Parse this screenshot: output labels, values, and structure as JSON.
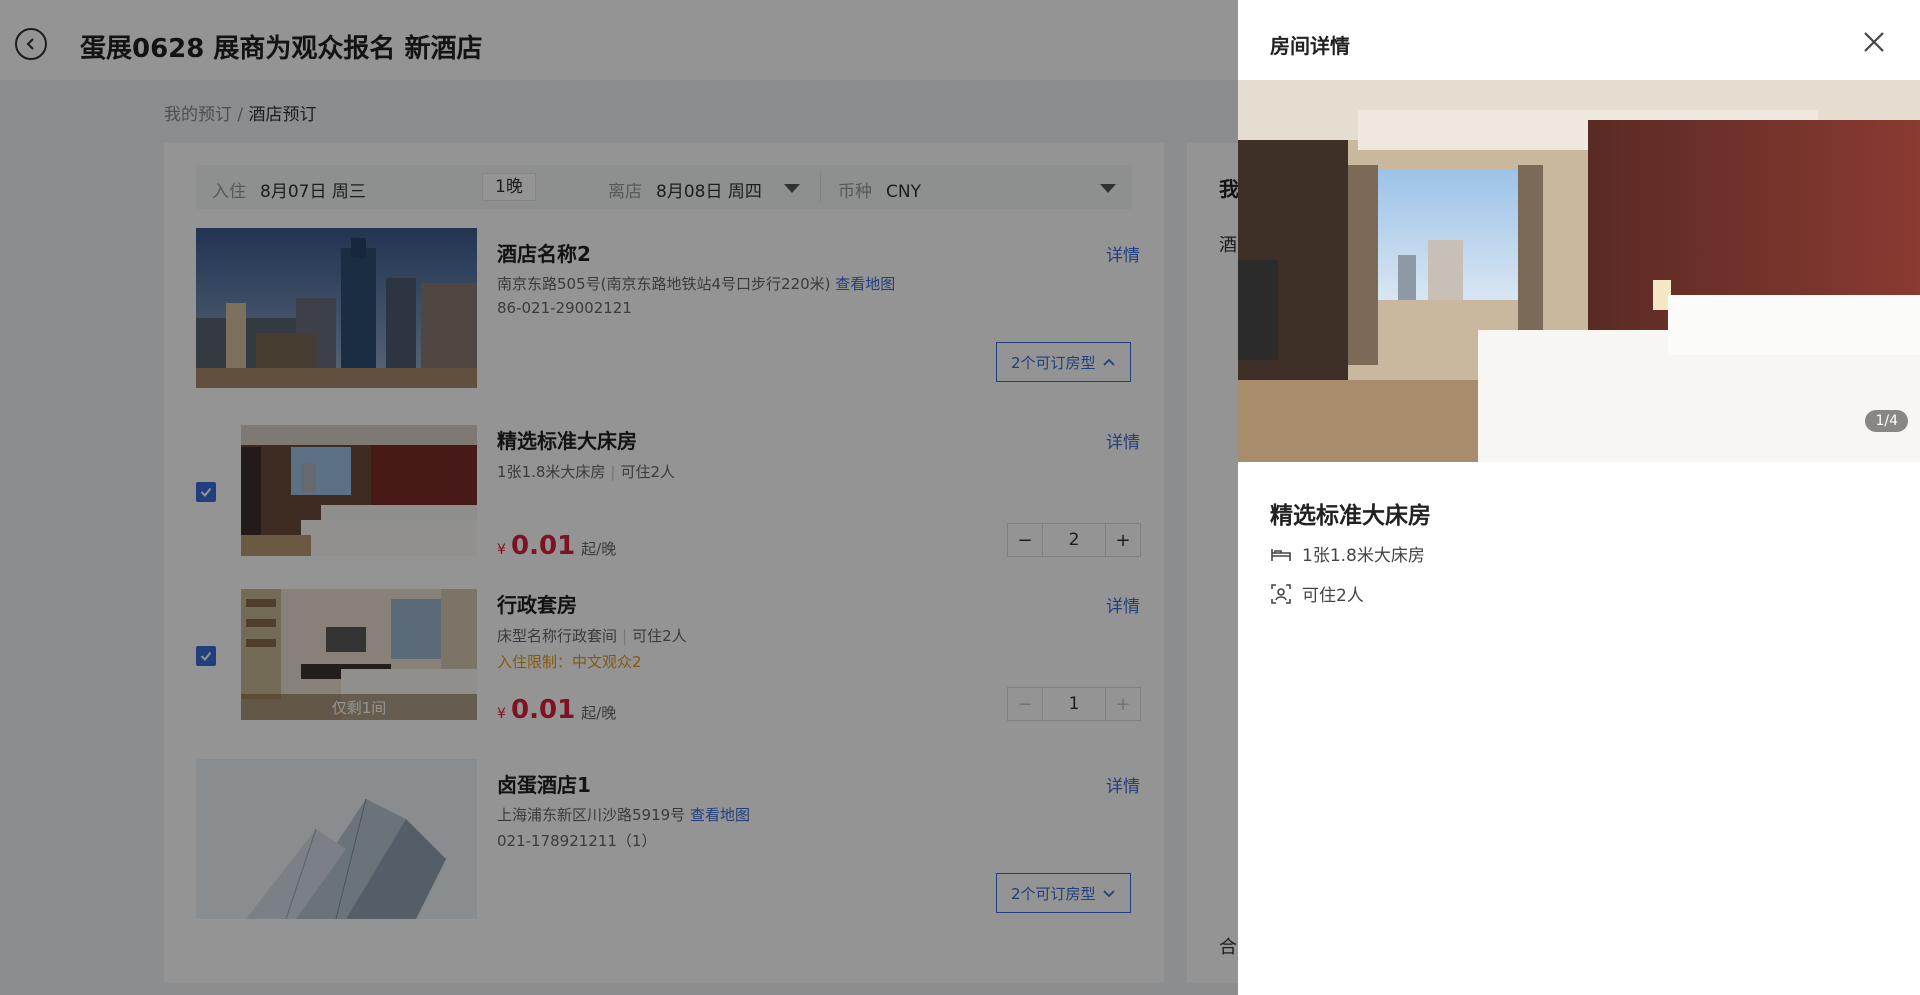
{
  "header": {
    "title": "蛋展0628 展商为观众报名 新酒店"
  },
  "breadcrumb": {
    "parent": "我的预订",
    "separator": " / ",
    "current": "酒店预订"
  },
  "filter": {
    "checkin_label": "入住",
    "checkin_value": "8月07日 周三",
    "nights": "1晚",
    "checkout_label": "离店",
    "checkout_value": "8月08日 周四",
    "currency_label": "币种",
    "currency_value": "CNY"
  },
  "hotels": [
    {
      "name": "酒店名称2",
      "address": "南京东路505号(南京东路地铁站4号口步行220米)",
      "map_link": "查看地图",
      "phone": "86-021-29002121",
      "detail": "详情",
      "room_types_button": "2个可订房型",
      "rooms": [
        {
          "name": "精选标准大床房",
          "bed": "1张1.8米大床房",
          "capacity": "可住2人",
          "currency": "¥",
          "price": "0.01",
          "price_unit": "起/晚",
          "detail": "详情",
          "quantity": "2",
          "minus": "−",
          "plus": "+"
        },
        {
          "name": "行政套房",
          "bed": "床型名称行政套间",
          "capacity": "可住2人",
          "restriction": "入住限制：中文观众2",
          "remaining": "仅剩1间",
          "currency": "¥",
          "price": "0.01",
          "price_unit": "起/晚",
          "detail": "详情",
          "quantity": "1",
          "minus": "−",
          "plus": "+"
        }
      ]
    },
    {
      "name": "卤蛋酒店1",
      "address": "上海浦东新区川沙路5919号",
      "map_link": "查看地图",
      "phone": "021-178921211（1）",
      "detail": "详情",
      "room_types_button": "2个可订房型"
    }
  ],
  "sidebar": {
    "title": "我",
    "hotel": "酒",
    "total": "合"
  },
  "drawer": {
    "title": "房间详情",
    "image_counter": "1/4",
    "room_name": "精选标准大床房",
    "bed": "1张1.8米大床房",
    "capacity": "可住2人"
  },
  "colors": {
    "accent": "#3b6cd8",
    "price": "#d8223c",
    "warning": "#e19a21"
  },
  "icons": [
    "back-icon",
    "chevron-up-icon",
    "chevron-down-icon",
    "close-icon",
    "bed-icon",
    "person-icon",
    "checkmark-icon"
  ]
}
